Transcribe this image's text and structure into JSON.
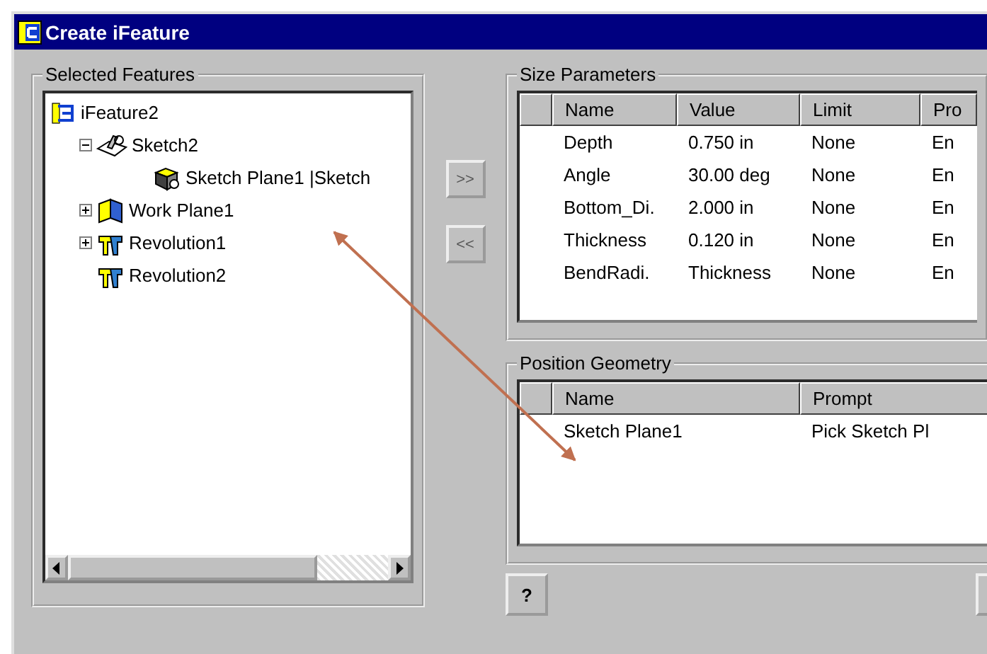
{
  "window": {
    "title": "Create iFeature"
  },
  "selected_features": {
    "title": "Selected Features",
    "tree": [
      {
        "label": "iFeature2",
        "kind": "ifeature",
        "children": [
          {
            "label": "Sketch2",
            "kind": "sketch",
            "expanded": true,
            "children": [
              {
                "label": "Sketch Plane1 |Sketch",
                "kind": "plane"
              }
            ]
          },
          {
            "label": "Work Plane1",
            "kind": "workplane",
            "expanded": false
          },
          {
            "label": "Revolution1",
            "kind": "revolution",
            "expanded": false
          },
          {
            "label": "Revolution2",
            "kind": "revolution"
          }
        ]
      }
    ]
  },
  "move_buttons": [
    {
      "label": ">>"
    },
    {
      "label": "<<"
    }
  ],
  "size_parameters": {
    "title": "Size Parameters",
    "columns": [
      "Name",
      "Value",
      "Limit",
      "Pro"
    ],
    "rows": [
      [
        "Depth",
        "0.750 in",
        "None",
        "En"
      ],
      [
        "Angle",
        "30.00 deg",
        "None",
        "En"
      ],
      [
        "Bottom_Di.",
        "2.000 in",
        "None",
        "En"
      ],
      [
        "Thickness",
        "0.120 in",
        "None",
        "En"
      ],
      [
        "BendRadi.",
        "Thickness",
        "None",
        "En"
      ]
    ]
  },
  "position_geometry": {
    "title": "Position Geometry",
    "columns": [
      "Name",
      "Prompt"
    ],
    "rows": [
      [
        "Sketch Plane1",
        "Pick Sketch Pl"
      ]
    ]
  },
  "help_button": {
    "label": "?"
  }
}
